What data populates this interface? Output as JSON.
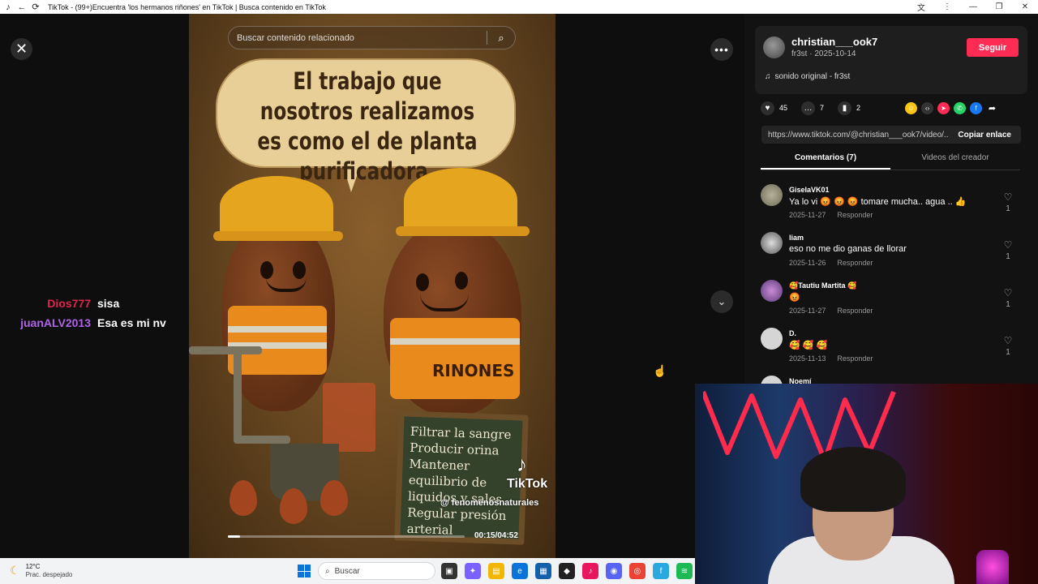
{
  "window": {
    "title": "TikTok - (99+)Encuentra 'los hermanos riñones' en TikTok | Busca contenido en TikTok",
    "back_icon": "arrow-left-icon",
    "refresh_icon": "refresh-icon",
    "controls": [
      "translate-icon",
      "more-vertical-icon",
      "minimize-icon",
      "restore-icon",
      "close-icon"
    ]
  },
  "stream_chat": [
    {
      "user": "Dios777",
      "message": "sisa",
      "color": "#e0264f"
    },
    {
      "user": "juanALV2013",
      "message": "Esa es mi nv",
      "color": "#b063e8"
    }
  ],
  "video": {
    "search_placeholder": "Buscar contenido relacionado",
    "speech_text": "El trabajo que nosotros realizamos es como el de planta purificadora.",
    "vest_label": "RINONES",
    "board_items": [
      "Filtrar la sangre",
      "Producir orina",
      "Mantener equilibrio de liquidos y sales",
      "Regular presión arterial"
    ],
    "watermark_brand": "TikTok",
    "watermark_handle": "@ fenomenosnaturales",
    "time": "00:15/04:52",
    "progress": 0.052
  },
  "panel": {
    "author": "christian___ook7",
    "subline": "fr3st · 2025-10-14",
    "follow_label": "Seguir",
    "music": "sonido original - fr3st",
    "likes": "45",
    "comments_count": "7",
    "saves": "2",
    "share_url": "https://www.tiktok.com/@christian___ook7/video/...",
    "copy_label": "Copiar enlace",
    "tabs": [
      {
        "label": "Comentarios (7)",
        "active": true
      },
      {
        "label": "Videos del creador",
        "active": false
      }
    ],
    "comments": [
      {
        "name": "GiselaVK01",
        "text": "Ya lo vi 😡 😡 😡  tomare mucha.. agua .. 👍",
        "date": "2025-11-27",
        "reply": "Responder",
        "likes": "1"
      },
      {
        "name": "liam",
        "text": "eso no me dio ganas de llorar",
        "date": "2025-11-26",
        "reply": "Responder",
        "likes": "1"
      },
      {
        "name": "🥰Tautiu Martita 🥰",
        "text": "😡",
        "date": "2025-11-27",
        "reply": "Responder",
        "likes": "1"
      },
      {
        "name": "D.",
        "text": "🥰 🥰 🥰",
        "date": "2025-11-13",
        "reply": "Responder",
        "likes": "1"
      },
      {
        "name": "Noemí",
        "text": "",
        "date": "",
        "reply": "",
        "likes": ""
      }
    ]
  },
  "taskbar": {
    "temp": "12°C",
    "weather": "Prac. despejado",
    "search_placeholder": "Buscar"
  },
  "colors": {
    "accent": "#fe2c55",
    "panel_bg": "#121212",
    "main_bg": "#0e0e0e"
  }
}
